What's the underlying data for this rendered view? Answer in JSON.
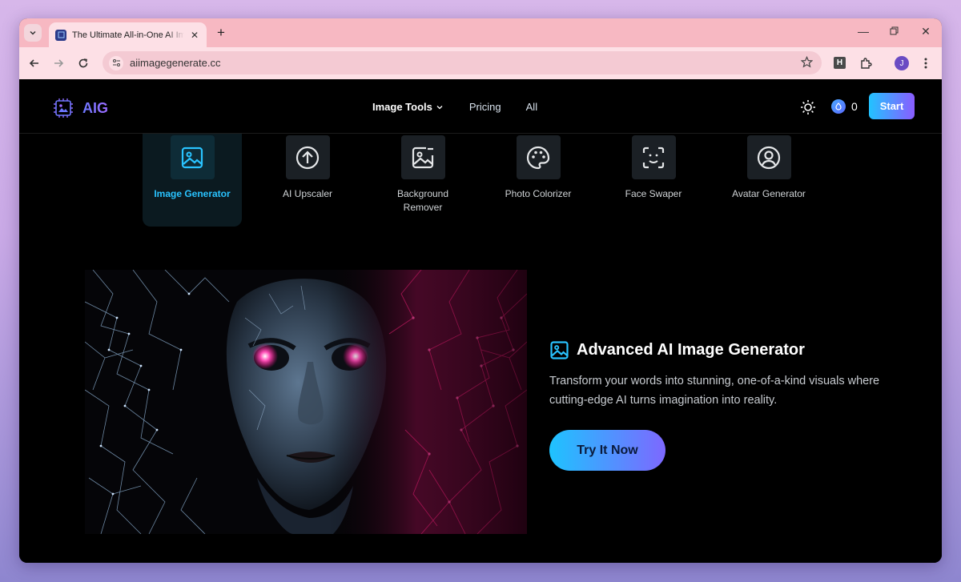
{
  "browser": {
    "tab_title": "The Ultimate All-in-One AI Image Generator",
    "url": "aiimagegenerate.cc",
    "profile_initial": "J",
    "extension_letter": "H"
  },
  "site": {
    "logo_text": "AIG",
    "nav": {
      "image_tools": "Image Tools",
      "pricing": "Pricing",
      "all": "All"
    },
    "credits": "0",
    "start_label": "Start",
    "tools": [
      {
        "label": "Image Generator",
        "icon": "image-icon"
      },
      {
        "label": "AI Upscaler",
        "icon": "arrow-up-circle-icon"
      },
      {
        "label": "Background Remover",
        "icon": "image-remove-icon"
      },
      {
        "label": "Photo Colorizer",
        "icon": "palette-icon"
      },
      {
        "label": "Face Swaper",
        "icon": "face-scan-icon"
      },
      {
        "label": "Avatar Generator",
        "icon": "user-circle-icon"
      }
    ],
    "hero": {
      "title": "Advanced AI Image Generator",
      "description": "Transform your words into stunning, one-of-a-kind visuals where cutting-edge AI turns imagination into reality.",
      "cta": "Try It Now"
    }
  },
  "colors": {
    "accent_cyan": "#29c3ff",
    "accent_purple": "#8a5cff",
    "tabbar_pink": "#f7b8c2"
  }
}
